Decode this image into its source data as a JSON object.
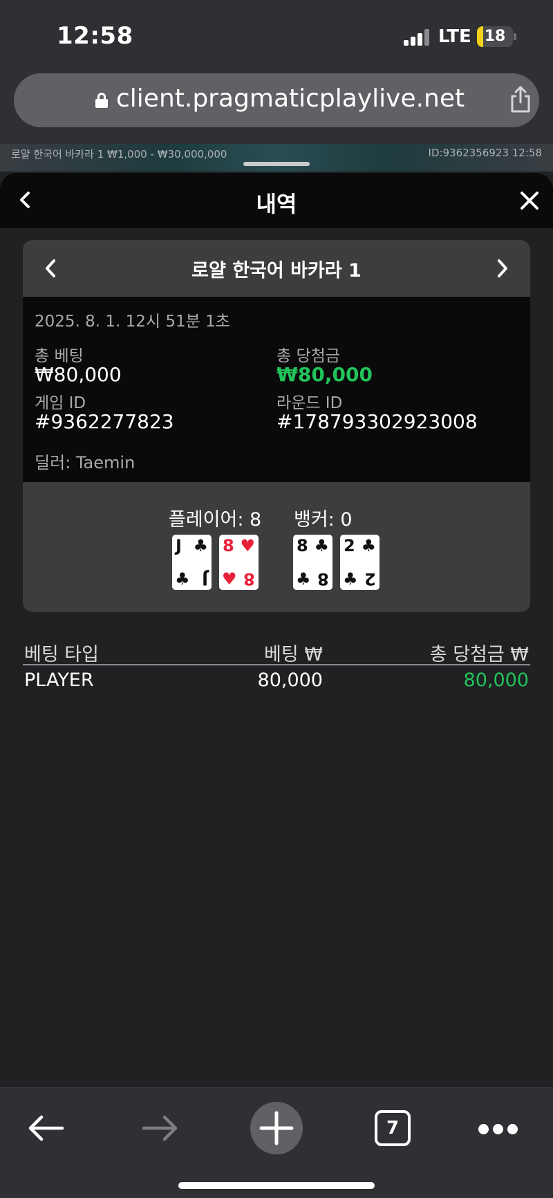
{
  "status": {
    "time": "12:58",
    "network": "LTE",
    "battery": "18",
    "battery_level": 0.18
  },
  "browser": {
    "url": "client.pragmaticplaylive.net"
  },
  "game_strip": {
    "left": "로얄 한국어 바카라 1  ₩1,000 - ₩30,000,000",
    "right": "ID:9362356923  12:58"
  },
  "sheet": {
    "title": "내역"
  },
  "round": {
    "table_name": "로얄 한국어 바카라 1",
    "datetime": "2025. 8. 1. 12시 51분 1초",
    "total_bet_label": "총 베팅",
    "total_bet": "₩80,000",
    "total_win_label": "총 당첨금",
    "total_win": "₩80,000",
    "game_id_label": "게임 ID",
    "game_id": "#9362277823",
    "round_id_label": "라운드 ID",
    "round_id": "#178793302923008",
    "dealer": "딜러: Taemin",
    "player_score": "플레이어: 8",
    "banker_score": "뱅커: 0",
    "player_cards": [
      {
        "rank": "J",
        "suit": "♣",
        "color": "black"
      },
      {
        "rank": "8",
        "suit": "♥",
        "color": "red"
      }
    ],
    "banker_cards": [
      {
        "rank": "8",
        "suit": "♣",
        "color": "black"
      },
      {
        "rank": "2",
        "suit": "♣",
        "color": "black"
      }
    ]
  },
  "bets": {
    "headers": [
      "베팅 타입",
      "베팅 ₩",
      "총 당첨금 ₩"
    ],
    "rows": [
      {
        "type": "PLAYER",
        "bet": "80,000",
        "win": "80,000"
      }
    ]
  },
  "toolbar": {
    "tab_count": "7"
  },
  "colors": {
    "win_green": "#21c45a",
    "card_red": "#e8223a"
  }
}
